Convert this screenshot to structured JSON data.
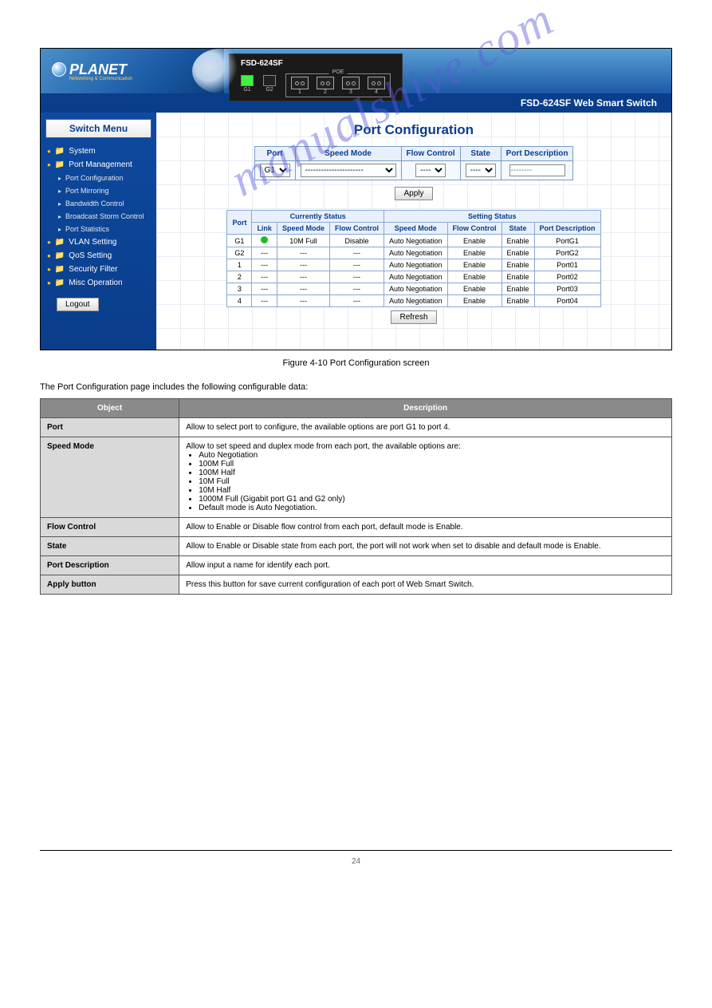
{
  "page": {
    "figure_caption": "Figure 4-10 Port Configuration screen",
    "below_intro": "The Port Configuration page includes the following configurable data:",
    "footer_page": "24"
  },
  "watermark": "manualshive.com",
  "banner": {
    "logo_text": "PLANET",
    "logo_sub": "Networking & Communication",
    "device_model": "FSD-624SF",
    "leds": [
      {
        "label": "G1",
        "on": true
      },
      {
        "label": "G2",
        "on": false
      }
    ],
    "poe_ports": [
      "1",
      "2",
      "3",
      "4"
    ],
    "subtitle": "FSD-624SF Web Smart Switch"
  },
  "sidebar": {
    "header": "Switch Menu",
    "items": [
      {
        "label": "System",
        "type": "folder"
      },
      {
        "label": "Port Management",
        "type": "folder"
      },
      {
        "label": "Port Configuration",
        "type": "sub"
      },
      {
        "label": "Port Mirroring",
        "type": "sub"
      },
      {
        "label": "Bandwidth Control",
        "type": "sub"
      },
      {
        "label": "Broadcast Storm Control",
        "type": "sub"
      },
      {
        "label": "Port Statistics",
        "type": "sub"
      },
      {
        "label": "VLAN Setting",
        "type": "folder"
      },
      {
        "label": "QoS Setting",
        "type": "folder"
      },
      {
        "label": "Security Filter",
        "type": "folder"
      },
      {
        "label": "Misc Operation",
        "type": "folder"
      }
    ],
    "logout": "Logout"
  },
  "content": {
    "title": "Port Configuration",
    "cfg_headers": [
      "Port",
      "Speed Mode",
      "Flow Control",
      "State",
      "Port Description"
    ],
    "cfg_values": {
      "port": "G1",
      "speed": "----------------------",
      "flow": "----",
      "state": "----",
      "desc_placeholder": "--------"
    },
    "apply": "Apply",
    "refresh": "Refresh",
    "status_group1": "Currently Status",
    "status_group2": "Setting Status",
    "status_headers": [
      "Port",
      "Link",
      "Speed Mode",
      "Flow Control",
      "Speed Mode",
      "Flow Control",
      "State",
      "Port Description"
    ],
    "status_rows": [
      {
        "port": "G1",
        "link": "green",
        "cs": "10M Full",
        "cf": "Disable",
        "ss": "Auto Negotiation",
        "sf": "Enable",
        "st": "Enable",
        "pd": "PortG1"
      },
      {
        "port": "G2",
        "link": "---",
        "cs": "---",
        "cf": "---",
        "ss": "Auto Negotiation",
        "sf": "Enable",
        "st": "Enable",
        "pd": "PortG2"
      },
      {
        "port": "1",
        "link": "---",
        "cs": "---",
        "cf": "---",
        "ss": "Auto Negotiation",
        "sf": "Enable",
        "st": "Enable",
        "pd": "Port01"
      },
      {
        "port": "2",
        "link": "---",
        "cs": "---",
        "cf": "---",
        "ss": "Auto Negotiation",
        "sf": "Enable",
        "st": "Enable",
        "pd": "Port02"
      },
      {
        "port": "3",
        "link": "---",
        "cs": "---",
        "cf": "---",
        "ss": "Auto Negotiation",
        "sf": "Enable",
        "st": "Enable",
        "pd": "Port03"
      },
      {
        "port": "4",
        "link": "---",
        "cs": "---",
        "cf": "---",
        "ss": "Auto Negotiation",
        "sf": "Enable",
        "st": "Enable",
        "pd": "Port04"
      }
    ]
  },
  "desc_table": {
    "header_obj": "Object",
    "header_desc": "Description",
    "rows": [
      {
        "obj": "Port",
        "desc": "Allow to select port to configure, the available options are port G1 to port 4."
      },
      {
        "obj": "Speed Mode",
        "desc_intro": "Allow to set speed and duplex mode from each port, the available options are:",
        "bullets": [
          "Auto Negotiation",
          "100M Full",
          "100M Half",
          "10M Full",
          "10M Half",
          "1000M Full (Gigabit port G1 and G2 only)",
          "Default mode is Auto Negotiation."
        ]
      },
      {
        "obj": "Flow Control",
        "desc": "Allow to Enable or Disable flow control from each port, default mode is Enable."
      },
      {
        "obj": "State",
        "desc": "Allow to Enable or Disable state from each port, the port will not work when set to disable and default mode is Enable."
      },
      {
        "obj": "Port Description",
        "desc": "Allow input a name for identify each port."
      },
      {
        "obj": "Apply button",
        "desc": "Press this button for save current configuration of each port of Web Smart Switch."
      }
    ]
  }
}
